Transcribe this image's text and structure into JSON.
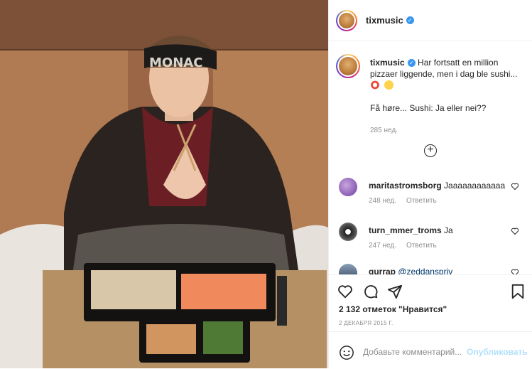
{
  "header": {
    "username": "tixmusic",
    "verified": true
  },
  "caption": {
    "username": "tixmusic",
    "text": "Har fortsatt en million pizzaer liggende, men i dag ble sushi...",
    "question": "Få høre... Sushi: Ja eller nei??",
    "time": "285 нед."
  },
  "comments": [
    {
      "username": "maritastromsborg",
      "text": "Jaaaaaaaaaaaa",
      "time": "248 нед.",
      "reply": "Ответить"
    },
    {
      "username": "turn_mmer_troms",
      "text": "Ja",
      "time": "247 нед.",
      "reply": "Ответить"
    },
    {
      "username": "gurrap",
      "text": "@zeddanspriv",
      "time": "",
      "reply": ""
    }
  ],
  "likes": "2 132 отметок \"Нравится\"",
  "date": "2 ДЕКАБРЯ 2015 Г.",
  "add_comment": {
    "placeholder": "Добавьте комментарий...",
    "post_label": "Опубликовать"
  },
  "photo": {
    "headband_text": "MONAC"
  },
  "colors": {
    "verified": "#3897f0",
    "link": "#00376b",
    "post_disabled": "#b2dffc",
    "muted": "#8e8e8e"
  },
  "icons": [
    "heart-icon",
    "comment-icon",
    "share-icon",
    "bookmark-icon",
    "add-icon",
    "smile-icon"
  ]
}
